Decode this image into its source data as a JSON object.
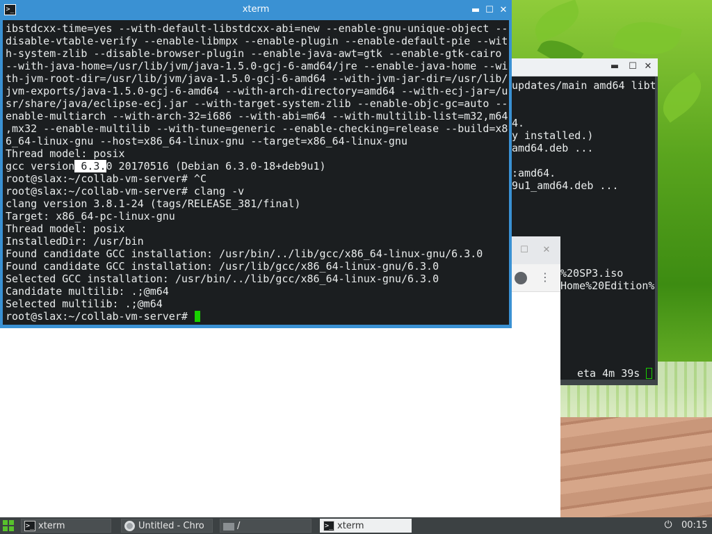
{
  "xterm": {
    "title": "xterm",
    "lines": [
      "ibstdcxx-time=yes --with-default-libstdcxx-abi=new --enable-gnu-unique-object --",
      "disable-vtable-verify --enable-libmpx --enable-plugin --enable-default-pie --wit",
      "h-system-zlib --disable-browser-plugin --enable-java-awt=gtk --enable-gtk-cairo",
      "--with-java-home=/usr/lib/jvm/java-1.5.0-gcj-6-amd64/jre --enable-java-home --wi",
      "th-jvm-root-dir=/usr/lib/jvm/java-1.5.0-gcj-6-amd64 --with-jvm-jar-dir=/usr/lib/",
      "jvm-exports/java-1.5.0-gcj-6-amd64 --with-arch-directory=amd64 --with-ecj-jar=/u",
      "sr/share/java/eclipse-ecj.jar --with-target-system-zlib --enable-objc-gc=auto --",
      "enable-multiarch --with-arch-32=i686 --with-abi=m64 --with-multilib-list=m32,m64",
      ",mx32 --enable-multilib --with-tune=generic --enable-checking=release --build=x8",
      "6_64-linux-gnu --host=x86_64-linux-gnu --target=x86_64-linux-gnu",
      "Thread model: posix"
    ],
    "gcc_prefix": "gcc version",
    "gcc_highlight": " 6.3.",
    "gcc_suffix": "0 20170516 (Debian 6.3.0-18+deb9u1)",
    "lines2": [
      "root@slax:~/collab-vm-server# ^C",
      "root@slax:~/collab-vm-server# clang -v",
      "clang version 3.8.1-24 (tags/RELEASE_381/final)",
      "Target: x86_64-pc-linux-gnu",
      "Thread model: posix",
      "InstalledDir: /usr/bin",
      "Found candidate GCC installation: /usr/bin/../lib/gcc/x86_64-linux-gnu/6.3.0",
      "Found candidate GCC installation: /usr/lib/gcc/x86_64-linux-gnu/6.3.0",
      "Selected GCC installation: /usr/bin/../lib/gcc/x86_64-linux-gnu/6.3.0",
      "Candidate multilib: .;@m64",
      "Selected multilib: .;@m64"
    ],
    "prompt": "root@slax:~/collab-vm-server# "
  },
  "bg_terminal": {
    "lines": [
      "updates/main amd64 libt",
      "",
      "4.",
      "y installed.)",
      "amd64.deb ...",
      "",
      ":amd64.",
      "9u1_amd64.deb ...",
      "",
      "",
      "",
      "",
      "",
      "%20SP3.iso",
      "Home%20Edition%"
    ],
    "status": "eta 4m 39s"
  },
  "taskbar": {
    "tasks": [
      {
        "label": "xterm",
        "icon": "terminal-icon"
      },
      {
        "label": "Untitled - Chro",
        "icon": "chrome-icon"
      },
      {
        "label": "/",
        "icon": "folder-icon"
      },
      {
        "label": "xterm",
        "icon": "terminal-icon"
      }
    ],
    "clock": "00:15"
  },
  "colors": {
    "titlebar_active": "#3a91d3",
    "terminal_bg": "#1b1e20",
    "terminal_fg": "#e9ecec",
    "cursor": "#18d000",
    "taskbar_bg": "#3c4143"
  }
}
